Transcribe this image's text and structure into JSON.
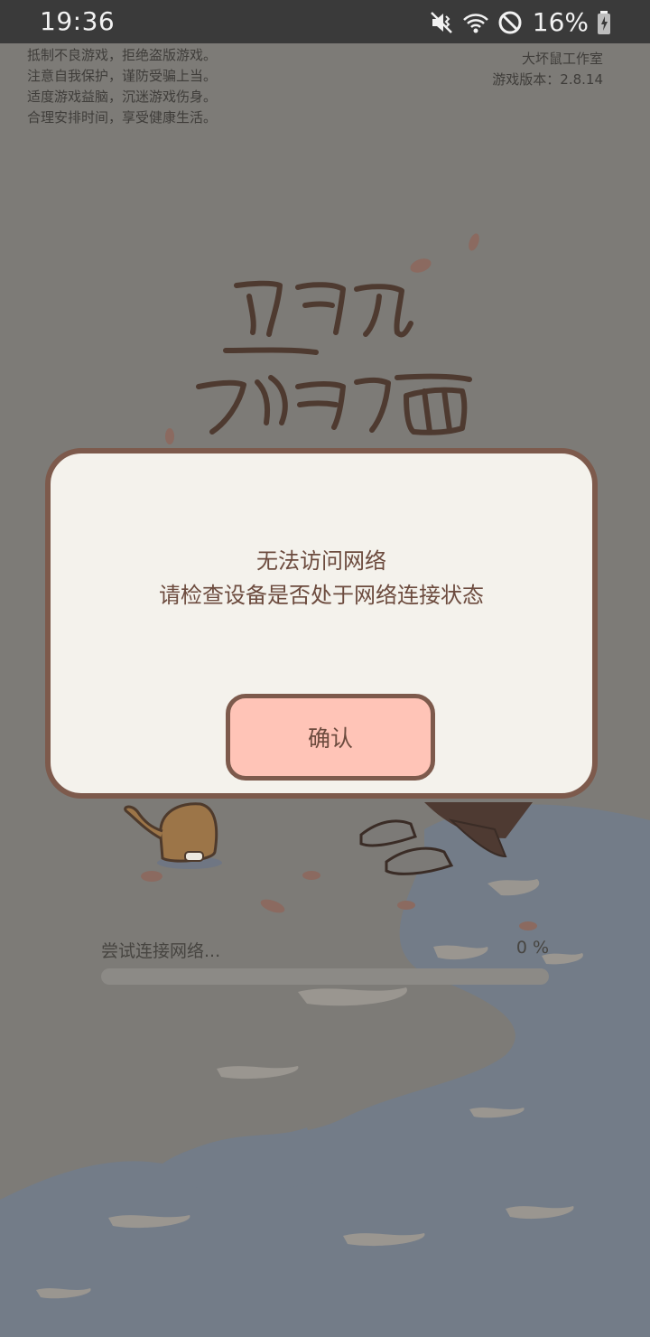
{
  "status_bar": {
    "time": "19:36",
    "battery": "16%",
    "icons": [
      "mute-vibrate-icon",
      "wifi-icon",
      "do-not-disturb-icon",
      "battery-charging-icon"
    ]
  },
  "game": {
    "health_notice": [
      "抵制不良游戏，拒绝盗版游戏。",
      "注意自我保护，谨防受骗上当。",
      "适度游戏益脑，沉迷游戏伤身。",
      "合理安排时间，享受健康生活。"
    ],
    "studio": "大坏鼠工作室",
    "version": "游戏版本：2.8.14",
    "loading": {
      "label": "尝试连接网络...",
      "percent_text": "0 %",
      "progress": 0
    }
  },
  "dialog": {
    "line1": "无法访问网络",
    "line2": "请检查设备是否处于网络连接状态",
    "confirm_label": "确认"
  },
  "colors": {
    "dialog_bg": "#f4f2ec",
    "dialog_border": "#7d5a4c",
    "button_bg": "#ffc4b7",
    "text_brown": "#6c4b3e"
  }
}
